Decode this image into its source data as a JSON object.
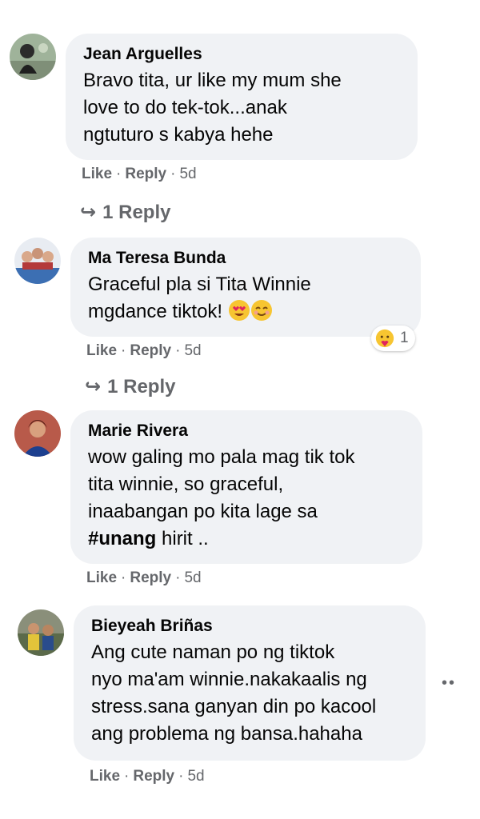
{
  "comments": [
    {
      "author": "Jean Arguelles",
      "text": "Bravo tita, ur like my mum she\nlove to do tek-tok...anak\nngtuturo s kabya hehe",
      "like": "Like",
      "reply": "Reply",
      "sep": "·",
      "time": "5d",
      "replies_label": "1 Reply"
    },
    {
      "author": "Ma Teresa Bunda",
      "text": "Graceful pla si Tita Winnie\nmgdance tiktok!",
      "emojis": [
        "heart-eyes-emoji",
        "smiling-emoji"
      ],
      "reaction_count": "1",
      "like": "Like",
      "reply": "Reply",
      "sep": "·",
      "time": "5d",
      "replies_label": "1 Reply"
    },
    {
      "author": "Marie Rivera",
      "text_before": "wow galing mo pala mag tik tok\ntita winnie, so graceful,\ninaabangan po kita lage sa\n",
      "hashtag": "#unang",
      "text_after": " hirit ..",
      "like": "Like",
      "reply": "Reply",
      "sep": "·",
      "time": "5d"
    },
    {
      "author": "Bieyeah Briñas",
      "text": "Ang cute naman po ng tiktok\nnyo ma'am winnie.nakakaalis ng\nstress.sana ganyan din po kacool\nang problema ng bansa.hahaha",
      "like": "Like",
      "reply": "Reply",
      "sep": "·",
      "time": "5d",
      "more": "••"
    }
  ],
  "colors": {
    "bubble": "#f0f2f5",
    "secondary_text": "#65676b",
    "primary_text": "#050505"
  }
}
